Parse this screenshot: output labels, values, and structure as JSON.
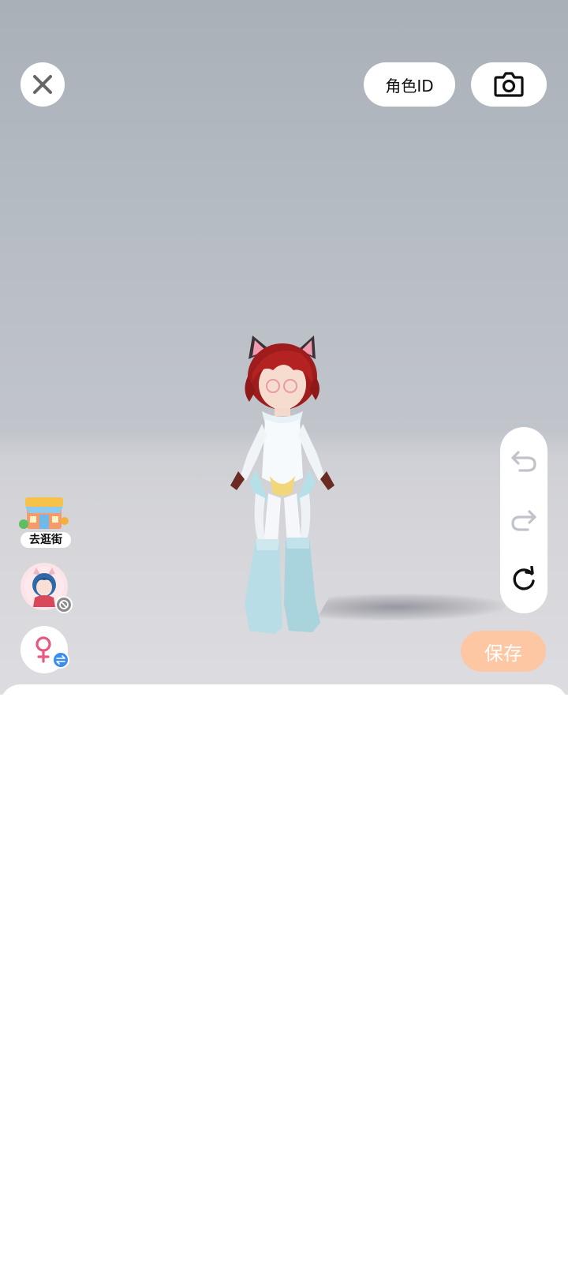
{
  "header": {
    "role_id_label": "角色ID",
    "close_icon": "close-icon",
    "camera_icon": "camera-icon"
  },
  "side_tools": {
    "undo_icon": "undo-icon",
    "redo_icon": "redo-icon",
    "reset_icon": "reset-icon"
  },
  "left_tools": {
    "shop_label": "去逛街",
    "avatar_icon": "avatar-icon",
    "gender_switch_icon": "gender-switch-icon"
  },
  "actions": {
    "save_label": "保存"
  },
  "colors": {
    "save_button": "#fdc7a3",
    "gender_pink": "#e8577f",
    "switch_blue": "#3b8ef0"
  }
}
